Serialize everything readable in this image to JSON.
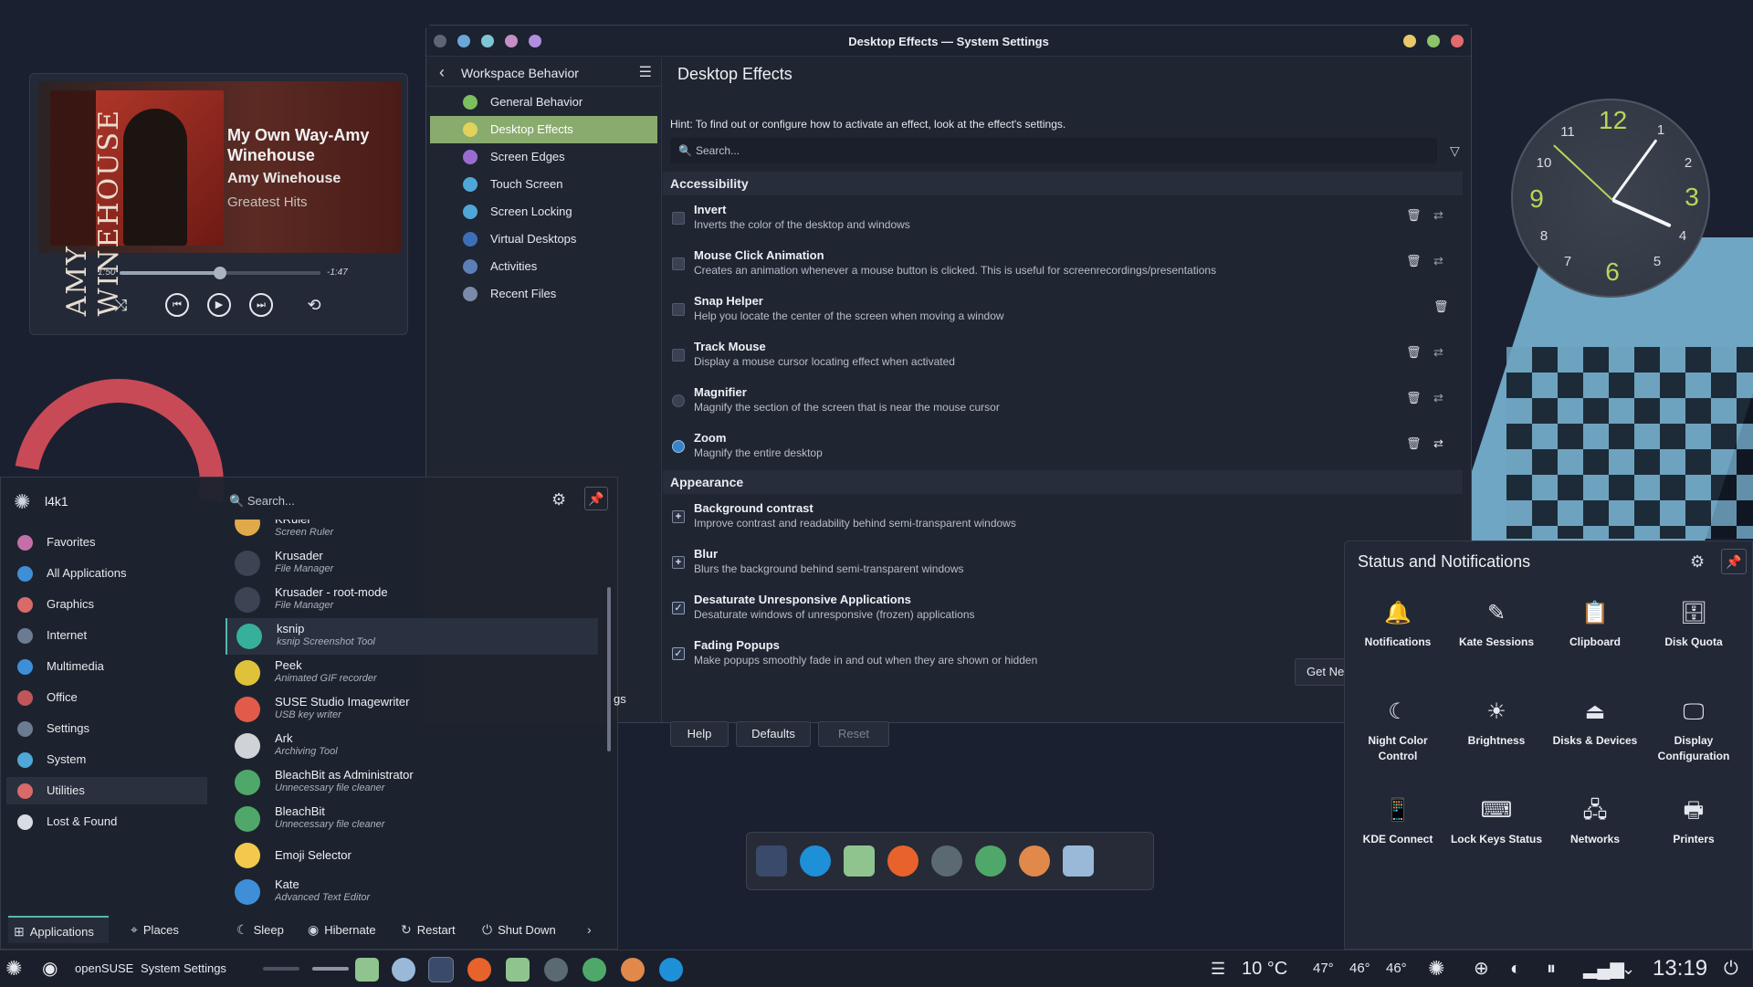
{
  "player": {
    "cover_text": "AMY WINEHOUSE",
    "title": "My Own Way-Amy Winehouse",
    "artist": "Amy Winehouse",
    "album": "Greatest Hits",
    "elapsed": "1:50",
    "remaining": "-1:47",
    "progress": 0.5
  },
  "window": {
    "title": "Desktop Effects — System Settings",
    "sidebar_title": "Workspace Behavior",
    "nav": [
      {
        "label": "General Behavior",
        "color": "#7bbf5e"
      },
      {
        "label": "Desktop Effects",
        "color": "#e0d25a",
        "active": true
      },
      {
        "label": "Screen Edges",
        "color": "#9a6cd0"
      },
      {
        "label": "Touch Screen",
        "color": "#4fa7d8"
      },
      {
        "label": "Screen Locking",
        "color": "#4fa7d8"
      },
      {
        "label": "Virtual Desktops",
        "color": "#3d6fb8"
      },
      {
        "label": "Activities",
        "color": "#5c7fb8"
      },
      {
        "label": "Recent Files",
        "color": "#7a8aa8"
      }
    ],
    "page_title": "Desktop Effects",
    "hint": "Hint: To find out or configure how to activate an effect, look at the effect's settings.",
    "search_placeholder": "Search...",
    "sections": {
      "accessibility": "Accessibility",
      "appearance": "Appearance"
    },
    "accessibility_effects": [
      {
        "name": "Invert",
        "desc": "Inverts the color of the desktop and windows",
        "type": "check",
        "checked": false
      },
      {
        "name": "Mouse Click Animation",
        "desc": "Creates an animation whenever a mouse button is clicked. This is useful for screenrecordings/presentations",
        "type": "check",
        "checked": false
      },
      {
        "name": "Snap Helper",
        "desc": "Help you locate the center of the screen when moving a window",
        "type": "check",
        "checked": false
      },
      {
        "name": "Track Mouse",
        "desc": "Display a mouse cursor locating effect when activated",
        "type": "check",
        "checked": false
      },
      {
        "name": "Magnifier",
        "desc": "Magnify the section of the screen that is near the mouse cursor",
        "type": "radio",
        "checked": false
      },
      {
        "name": "Zoom",
        "desc": "Magnify the entire desktop",
        "type": "radio",
        "checked": true
      }
    ],
    "appearance_effects": [
      {
        "name": "Background contrast",
        "desc": "Improve contrast and readability behind semi-transparent windows",
        "type": "plus"
      },
      {
        "name": "Blur",
        "desc": "Blurs the background behind semi-transparent windows",
        "type": "plus"
      },
      {
        "name": "Desaturate Unresponsive Applications",
        "desc": "Desaturate windows of unresponsive (frozen) applications",
        "type": "check",
        "checked": true
      },
      {
        "name": "Fading Popups",
        "desc": "Make popups smoothly fade in and out when they are shown or hidden",
        "type": "check",
        "checked": true
      }
    ],
    "get_new": "Get Ne",
    "hidden_btn_fragment": "gs",
    "buttons": {
      "help": "Help",
      "defaults": "Defaults",
      "reset": "Reset"
    }
  },
  "launcher": {
    "user": "l4k1",
    "search_placeholder": "Search...",
    "categories": [
      {
        "label": "Favorites",
        "color": "#c46fa8"
      },
      {
        "label": "All Applications",
        "color": "#3f8fd8"
      },
      {
        "label": "Graphics",
        "color": "#d86a6a"
      },
      {
        "label": "Internet",
        "color": "#6b7c92"
      },
      {
        "label": "Multimedia",
        "color": "#3f8fd8"
      },
      {
        "label": "Office",
        "color": "#c0565a"
      },
      {
        "label": "Settings",
        "color": "#6b7c92"
      },
      {
        "label": "System",
        "color": "#4fa7d8"
      },
      {
        "label": "Utilities",
        "color": "#d86a6a",
        "active": true
      },
      {
        "label": "Lost & Found",
        "color": "#d8dde3"
      }
    ],
    "apps": [
      {
        "name": "KRuler",
        "desc": "Screen Ruler",
        "color": "#e0a94a"
      },
      {
        "name": "Krusader",
        "desc": "File Manager",
        "color": "#3c4453"
      },
      {
        "name": "Krusader - root-mode",
        "desc": "File Manager",
        "color": "#3c4453"
      },
      {
        "name": "ksnip",
        "desc": "ksnip Screenshot Tool",
        "color": "#36b09a",
        "hl": true
      },
      {
        "name": "Peek",
        "desc": "Animated GIF recorder",
        "color": "#e0c23a"
      },
      {
        "name": "SUSE Studio Imagewriter",
        "desc": "USB key writer",
        "color": "#e25b4a"
      },
      {
        "name": "Ark",
        "desc": "Archiving Tool",
        "color": "#cfd3d8"
      },
      {
        "name": "BleachBit as Administrator",
        "desc": "Unnecessary file cleaner",
        "color": "#4fa86a"
      },
      {
        "name": "BleachBit",
        "desc": "Unnecessary file cleaner",
        "color": "#4fa86a"
      },
      {
        "name": "Emoji Selector",
        "desc": "",
        "color": "#f2c94c"
      },
      {
        "name": "Kate",
        "desc": "Advanced Text Editor",
        "color": "#3f8fd8"
      }
    ],
    "footer": {
      "applications": "Applications",
      "places": "Places",
      "sleep": "Sleep",
      "hibernate": "Hibernate",
      "restart": "Restart",
      "shutdown": "Shut Down"
    }
  },
  "clock": {
    "time_shown": "13:19"
  },
  "status": {
    "title": "Status and Notifications",
    "tiles": [
      {
        "label": "Notifications",
        "icon": "bell-icon"
      },
      {
        "label": "Kate Sessions",
        "icon": "kate-icon"
      },
      {
        "label": "Clipboard",
        "icon": "clipboard-icon"
      },
      {
        "label": "Disk Quota",
        "icon": "disk-quota-icon"
      },
      {
        "label": "Night Color Control",
        "icon": "night-color-icon"
      },
      {
        "label": "Brightness",
        "icon": "brightness-icon"
      },
      {
        "label": "Disks & Devices",
        "icon": "usb-icon"
      },
      {
        "label": "Display Configuration",
        "icon": "display-icon"
      },
      {
        "label": "KDE Connect",
        "icon": "phone-icon"
      },
      {
        "label": "Lock Keys Status",
        "icon": "keyboard-icon"
      },
      {
        "label": "Networks",
        "icon": "network-icon"
      },
      {
        "label": "Printers",
        "icon": "printer-icon"
      }
    ]
  },
  "taskbar": {
    "distro": "openSUSE",
    "active_window": "System Settings",
    "weather": "10 °C",
    "temps": [
      "47°",
      "46°",
      "46°"
    ],
    "time": "13:19"
  }
}
